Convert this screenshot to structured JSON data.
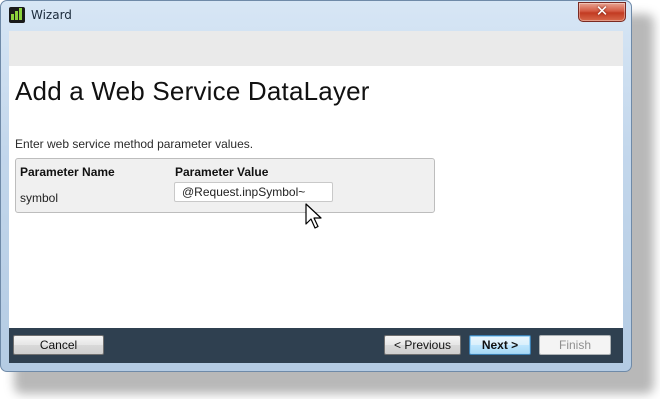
{
  "window": {
    "title": "Wizard",
    "close_glyph": "✕"
  },
  "page": {
    "heading": "Add a Web Service DataLayer",
    "instruction": "Enter web service method parameter values."
  },
  "params_table": {
    "columns": [
      "Parameter Name",
      "Parameter Value"
    ],
    "rows": [
      {
        "name": "symbol",
        "value": "@Request.inpSymbol~"
      }
    ]
  },
  "footer": {
    "cancel_label": "Cancel",
    "previous_label": "< Previous",
    "next_label": "Next >",
    "finish_label": "Finish"
  },
  "colors": {
    "footer_bg": "#2f4050",
    "banner_bg": "#eaeaea",
    "app_icon_bars": "#8cd23c"
  }
}
